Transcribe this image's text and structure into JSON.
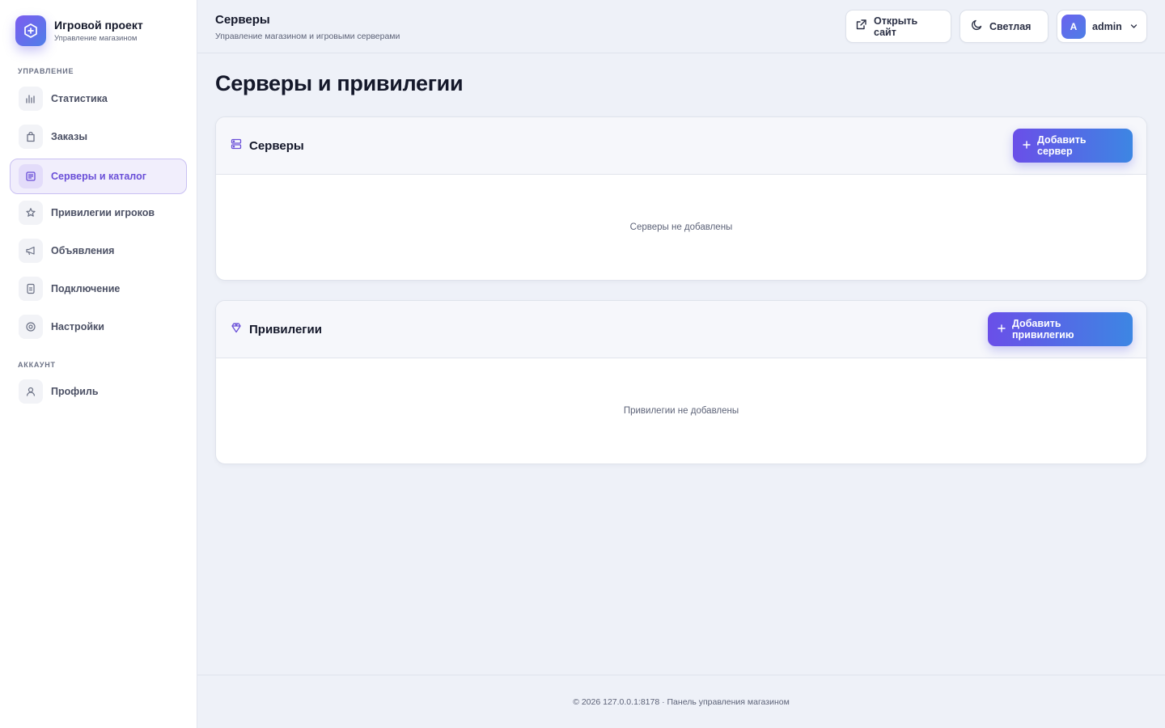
{
  "brand": {
    "title": "Игровой проект",
    "subtitle": "Управление магазином",
    "icon": "hexagon-plus-icon",
    "accent": "#6a4fe8"
  },
  "sidebar": {
    "sections": [
      {
        "label": "УПРАВЛЕНИЕ"
      },
      {
        "label": "АККАУНТ"
      }
    ],
    "items": [
      {
        "label": "Статистика",
        "icon": "bar-chart-icon",
        "active": false
      },
      {
        "label": "Заказы",
        "icon": "shopping-bag-icon",
        "active": false
      },
      {
        "label": "Серверы и каталог",
        "icon": "catalog-icon",
        "active": true
      },
      {
        "label": "Привилегии игроков",
        "icon": "star-icon",
        "active": false
      },
      {
        "label": "Объявления",
        "icon": "megaphone-icon",
        "active": false
      },
      {
        "label": "Подключение",
        "icon": "document-icon",
        "active": false
      },
      {
        "label": "Настройки",
        "icon": "gear-icon",
        "active": false
      },
      {
        "label": "Профиль",
        "icon": "user-icon",
        "active": false
      }
    ]
  },
  "header": {
    "title": "Серверы",
    "subtitle": "Управление магазином и игровыми серверами",
    "open_site_label": "Открыть сайт",
    "theme_label": "Светлая",
    "user_initial": "A",
    "user_name": "admin"
  },
  "main": {
    "page_title": "Серверы и привилегии",
    "servers": {
      "title": "Серверы",
      "add_label": "Добавить сервер",
      "empty_text": "Серверы не добавлены"
    },
    "privileges": {
      "title": "Привилегии",
      "add_label": "Добавить привилегию",
      "empty_text": "Привилегии не добавлены"
    }
  },
  "footer": {
    "text": "© 2026 127.0.0.1:8178 · Панель управления магазином"
  }
}
